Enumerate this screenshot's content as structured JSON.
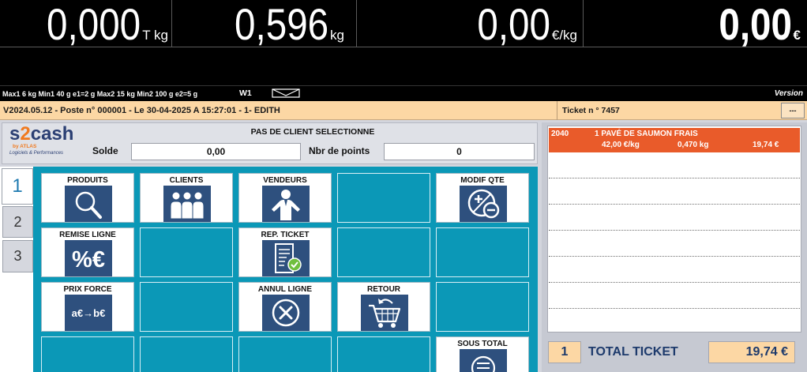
{
  "display": {
    "tare": {
      "value": "0,000",
      "unit": "T kg"
    },
    "weight": {
      "value": "0,596",
      "unit": "kg"
    },
    "unit_price": {
      "value": "0,00",
      "unit": "€/kg"
    },
    "price": {
      "value": "0,00",
      "unit": "€"
    }
  },
  "info_bar": {
    "specs": "Max1 6 kg Min1 40 g e1=2 g Max2 15 kg Min2 100 g e2=5 g",
    "scale_id": "W1",
    "message_icon": "envelope-icon",
    "version_label": "Version"
  },
  "status_bar": {
    "session": "V2024.05.12 - Poste n° 000001 - Le 30-04-2025 A 15:27:01 - 1- EDITH",
    "ticket": "Ticket n ° 7457",
    "menu_button": "---"
  },
  "logo": {
    "s": "s",
    "two": "2",
    "cash": "cash",
    "by": "by ATLAS",
    "tagline": "Logiciels & Performances"
  },
  "client": {
    "status": "PAS DE CLIENT SELECTIONNE",
    "balance_label": "Solde",
    "balance_value": "0,00",
    "points_label": "Nbr de points",
    "points_value": "0"
  },
  "tabs": [
    {
      "label": "1",
      "selected": true
    },
    {
      "label": "2",
      "selected": false
    },
    {
      "label": "3",
      "selected": false
    }
  ],
  "functions": [
    {
      "label": "PRODUITS",
      "icon": "search-icon"
    },
    {
      "label": "CLIENTS",
      "icon": "customers-icon"
    },
    {
      "label": "VENDEURS",
      "icon": "salesperson-icon"
    },
    {
      "label": "MODIF QTE",
      "icon": "plus-minus-icon"
    },
    {
      "label": "REMISE LIGNE",
      "icon": "discount-icon",
      "icon_text": "%€"
    },
    {
      "label": "REP. TICKET",
      "icon": "receipt-check-icon"
    },
    {
      "label": "PRIX FORCE",
      "icon": "forced-price-icon",
      "icon_text": "a€→b€"
    },
    {
      "label": "ANNUL LIGNE",
      "icon": "cancel-line-icon"
    },
    {
      "label": "RETOUR",
      "icon": "return-cart-icon"
    },
    {
      "label": "SOUS TOTAL",
      "icon": "subtotal-icon"
    }
  ],
  "ticket": {
    "lines": [
      {
        "code": "2040",
        "description": "1 PAVÉ DE SAUMON FRAIS",
        "unit_price": "42,00 €/kg",
        "weight": "0,470 kg",
        "amount": "19,74 €"
      }
    ]
  },
  "total": {
    "count": "1",
    "label": "TOTAL TICKET",
    "value": "19,74 €"
  },
  "colors": {
    "display_bg": "#000000",
    "status_bar": "#fcd7a4",
    "function_area": "#0b98b7",
    "icon_bg": "#2e507e",
    "selected_line": "#e95b2a",
    "total_text": "#1d3a6c",
    "logo_orange": "#f07a1f"
  }
}
